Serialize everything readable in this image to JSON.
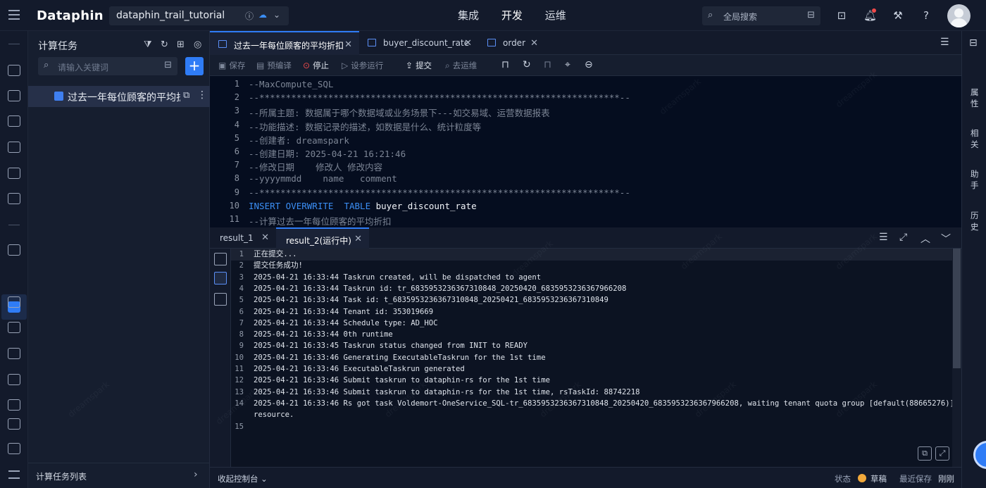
{
  "topbar": {
    "brand": "Dataphin",
    "project": "dataphin_trail_tutorial",
    "nav": [
      "集成",
      "开发",
      "运维"
    ],
    "active_nav": "开发",
    "search_placeholder": "全局搜索"
  },
  "panel": {
    "title": "计算任务",
    "search_placeholder": "请输入关键词",
    "add_label": "+",
    "tree_item": "过去一年每位顾客的平均折扣",
    "footer_label": "计算任务列表"
  },
  "tabs": [
    {
      "label": "过去一年每位顾客的平均折扣"
    },
    {
      "label": "buyer_discount_rate"
    },
    {
      "label": "order"
    }
  ],
  "toolbar": {
    "save": "保存",
    "precompile": "预编译",
    "stop": "停止",
    "run_params": "设参运行",
    "submit": "提交",
    "to_ops": "去运维"
  },
  "editor": {
    "lines": [
      {
        "n": "1",
        "text": "--MaxCompute_SQL",
        "kw": false
      },
      {
        "n": "2",
        "text": "--********************************************************************--",
        "kw": false
      },
      {
        "n": "3",
        "text": "--所属主题: 数据属于哪个数据域或业务场景下---如交易域、运营数据报表",
        "kw": false
      },
      {
        "n": "4",
        "text": "--功能描述: 数据记录的描述，如数据是什么、统计粒度等",
        "kw": false
      },
      {
        "n": "5",
        "text": "--创建者: dreamspark",
        "kw": false
      },
      {
        "n": "6",
        "text": "--创建日期: 2025-04-21 16:21:46",
        "kw": false
      },
      {
        "n": "7",
        "text": "--修改日期    修改人 修改内容",
        "kw": false
      },
      {
        "n": "8",
        "text": "--yyyymmdd    name   comment",
        "kw": false
      },
      {
        "n": "9",
        "text": "--********************************************************************--",
        "kw": false
      },
      {
        "n": "10",
        "text": "INSERT OVERWRITE  TABLE ",
        "kw": true,
        "table": "buyer_discount_rate"
      },
      {
        "n": "11",
        "text": "--计算过去一年每位顾客的平均折扣",
        "kw": false
      }
    ]
  },
  "right_rail": [
    "属性",
    "相关",
    "助手",
    "历史"
  ],
  "result_tabs": [
    {
      "label": "result_1"
    },
    {
      "label": "result_2(运行中)"
    }
  ],
  "logs": [
    {
      "n": "1",
      "text": "正在提交..."
    },
    {
      "n": "2",
      "text": "提交任务成功!"
    },
    {
      "n": "3",
      "text": "2025-04-21 16:33:44 Taskrun created, will be dispatched to agent"
    },
    {
      "n": "4",
      "text": "2025-04-21 16:33:44 Taskrun id: tr_6835953236367310848_20250420_6835953236367966208"
    },
    {
      "n": "5",
      "text": "2025-04-21 16:33:44 Task id: t_6835953236367310848_20250421_6835953236367310849"
    },
    {
      "n": "6",
      "text": "2025-04-21 16:33:44 Tenant id: 353019669"
    },
    {
      "n": "7",
      "text": "2025-04-21 16:33:44 Schedule type: AD_HOC"
    },
    {
      "n": "8",
      "text": "2025-04-21 16:33:44 0th runtime"
    },
    {
      "n": "9",
      "text": "2025-04-21 16:33:45 Taskrun status changed from INIT to READY"
    },
    {
      "n": "10",
      "text": "2025-04-21 16:33:46 Generating ExecutableTaskrun for the 1st time"
    },
    {
      "n": "11",
      "text": "2025-04-21 16:33:46 ExecutableTaskrun generated"
    },
    {
      "n": "12",
      "text": "2025-04-21 16:33:46 Submit taskrun to dataphin-rs for the 1st time"
    },
    {
      "n": "13",
      "text": "2025-04-21 16:33:46 Submit taskrun to dataphin-rs for the 1st time, rsTaskId: 88742218"
    },
    {
      "n": "14",
      "text": "2025-04-21 16:33:46 Rs got task Voldemort-OneService_SQL-tr_6835953236367310848_20250420_6835953236367966208, waiting tenant quota group [default(88665276)]"
    },
    {
      "n": "",
      "text": "resource."
    },
    {
      "n": "15",
      "text": ""
    }
  ],
  "footer": {
    "collapse": "收起控制台",
    "status_label": "状态",
    "status_value": "草稿",
    "last_saved_label": "最近保存",
    "last_saved_value": "刚刚"
  },
  "watermark": "dreamspark"
}
